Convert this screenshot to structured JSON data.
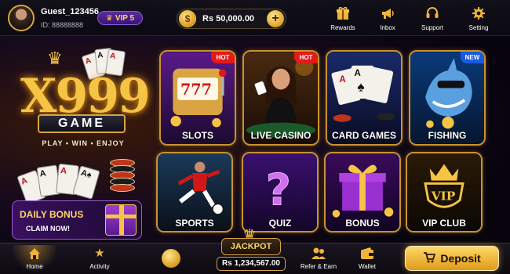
{
  "user": {
    "name": "Guest_123456",
    "id": "ID: 88888888",
    "vip": "VIP 5"
  },
  "wallet": {
    "currency_symbol": "$",
    "balance": "Rs 50,000.00",
    "add": "+"
  },
  "topnav": [
    {
      "label": "Rewards",
      "icon": "gift-icon"
    },
    {
      "label": "Inbox",
      "icon": "megaphone-icon"
    },
    {
      "label": "Support",
      "icon": "headset-icon"
    },
    {
      "label": "Setting",
      "icon": "gear-icon"
    }
  ],
  "logo": {
    "title": "X999",
    "subtitle": "GAME",
    "tagline": "PLAY • WIN • ENJOY"
  },
  "daily_bonus": {
    "title": "DAILY BONUS",
    "subtitle": "CLAIM NOW!"
  },
  "games": [
    {
      "label": "SLOTS",
      "badge": "HOT"
    },
    {
      "label": "LIVE CASINO",
      "badge": "HOT"
    },
    {
      "label": "CARD GAMES",
      "badge": ""
    },
    {
      "label": "FISHING",
      "badge": "NEW"
    },
    {
      "label": "SPORTS",
      "badge": ""
    },
    {
      "label": "QUIZ",
      "badge": ""
    },
    {
      "label": "BONUS",
      "badge": ""
    },
    {
      "label": "VIP CLUB",
      "badge": ""
    }
  ],
  "bottomnav": [
    {
      "label": "Home",
      "icon": "home-icon"
    },
    {
      "label": "Activity",
      "icon": "star-icon"
    },
    {
      "label": "Refer & Earn",
      "icon": "users-icon"
    },
    {
      "label": "Wallet",
      "icon": "wallet-icon"
    }
  ],
  "jackpot": {
    "label": "JACKPOT",
    "value": "Rs 1,234,567.00"
  },
  "deposit": {
    "label": "Deposit"
  },
  "colors": {
    "accent": "#f0b43a",
    "hot": "#e21a1a",
    "new": "#1a5ae0",
    "vip": "#5a2aa0"
  }
}
